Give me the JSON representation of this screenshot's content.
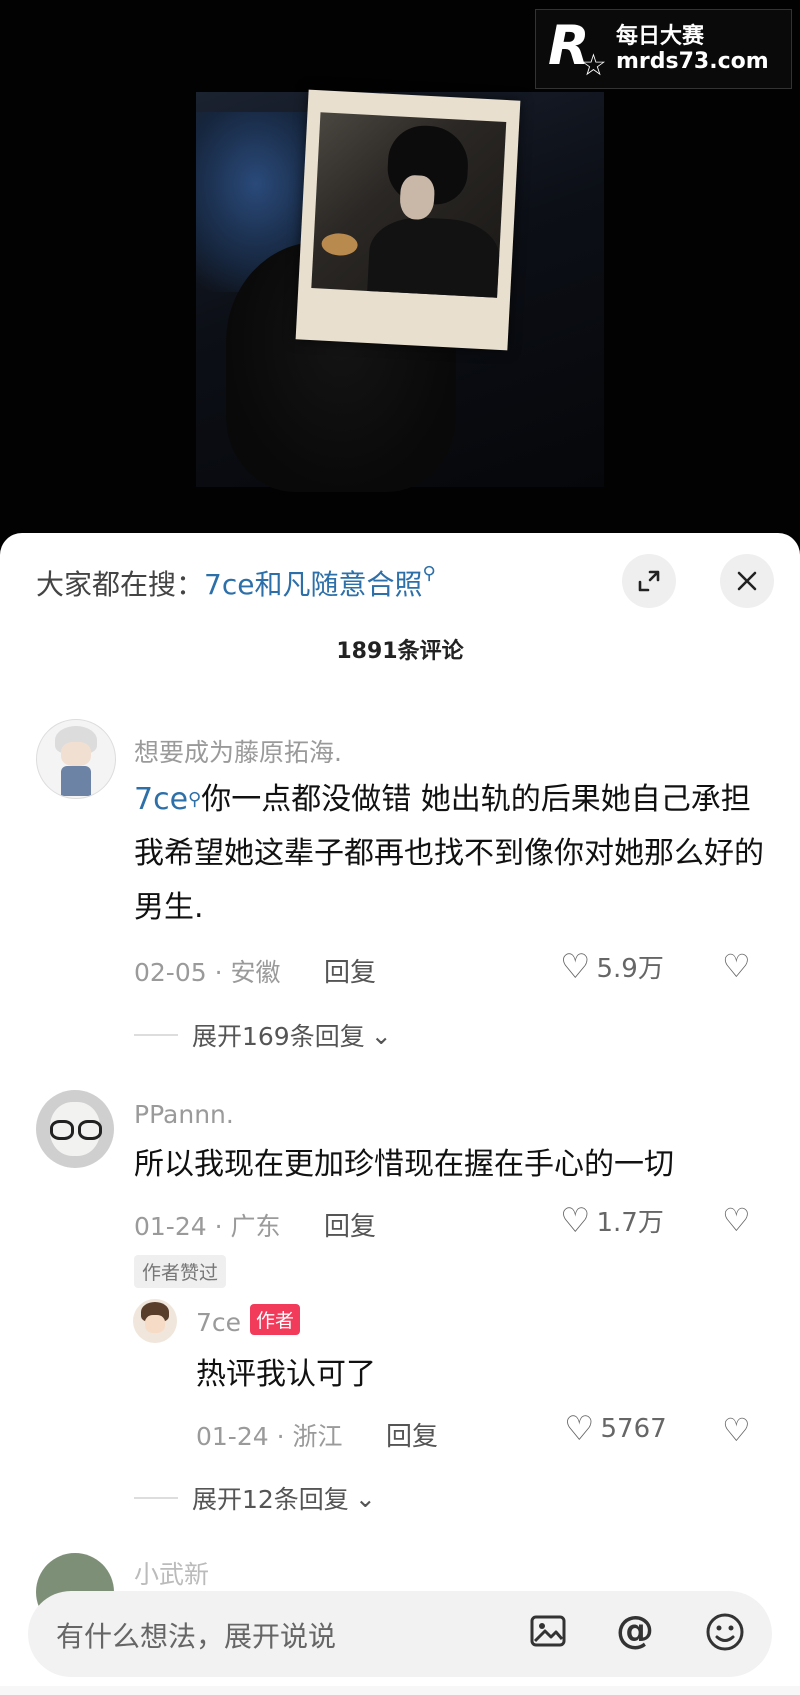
{
  "watermark": {
    "logo_letter": "R",
    "brand_cn": "每日大赛",
    "site": "mrds73.com"
  },
  "search_hint": {
    "prefix": "大家都在搜：",
    "keyword": "7ce和凡随意合照"
  },
  "comment_count": "1891条评论",
  "comments": [
    {
      "user": "想要成为藤原拓海.",
      "mention": "7ce",
      "text": "你一点都没做错 她出轨的后果她自己承担 我希望她这辈子都再也找不到像你对她那么好的男生.",
      "meta": "02-05 · 安徽",
      "reply_label": "回复",
      "likes": "5.9万",
      "expand": "展开169条回复"
    },
    {
      "user": "PPannn.",
      "text": "所以我现在更加珍惜现在握在手心的一切",
      "meta": "01-24 · 广东",
      "reply_label": "回复",
      "likes": "1.7万",
      "author_liked": "作者赞过",
      "sub_reply": {
        "user": "7ce",
        "author_tag": "作者",
        "text": "热评我认可了",
        "meta": "01-24 · 浙江",
        "reply_label": "回复",
        "likes": "5767"
      },
      "expand": "展开12条回复"
    }
  ],
  "partial_next_user": "小武新",
  "input": {
    "placeholder": "有什么想法，展开说说"
  },
  "icons": [
    "expand-icon",
    "close-icon",
    "heart-icon",
    "dislike-icon",
    "image-icon",
    "at-icon",
    "emoji-icon",
    "search-icon",
    "chevron-down-icon"
  ]
}
